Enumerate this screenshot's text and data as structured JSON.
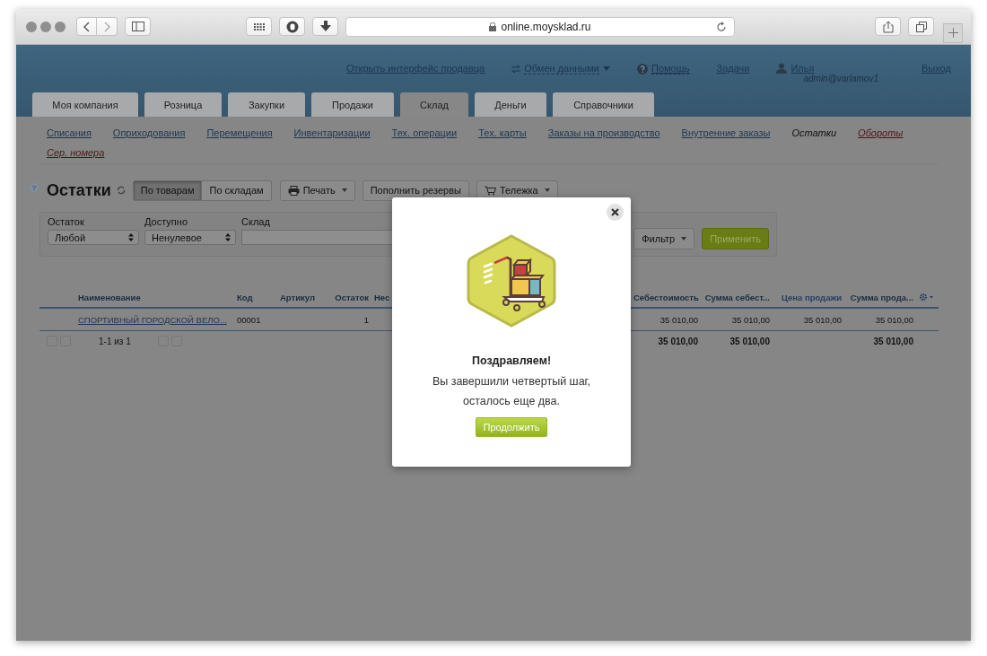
{
  "browser": {
    "url": "online.moysklad.ru"
  },
  "top_links": [
    {
      "label": "Открыть интерфейс продавца",
      "kind": "link"
    },
    {
      "label": "Обмен данными",
      "kind": "dropdown"
    },
    {
      "label": "Помощь",
      "kind": "help"
    },
    {
      "label": "Задачи",
      "kind": "link"
    },
    {
      "label": "Илья",
      "sub": "admin@varlamov1",
      "kind": "user"
    },
    {
      "label": "Выход",
      "kind": "link"
    }
  ],
  "tabs": [
    {
      "label": "Моя компания",
      "selected": false
    },
    {
      "label": "Розница",
      "selected": false
    },
    {
      "label": "Закупки",
      "selected": false
    },
    {
      "label": "Продажи",
      "selected": false
    },
    {
      "label": "Склад",
      "selected": true
    },
    {
      "label": "Деньги",
      "selected": false
    },
    {
      "label": "Справочники",
      "selected": false
    }
  ],
  "subnav": [
    {
      "label": "Списания",
      "selected": false,
      "kind": "normal"
    },
    {
      "label": "Оприходования",
      "selected": false,
      "kind": "normal"
    },
    {
      "label": "Перемещения",
      "selected": false,
      "kind": "normal"
    },
    {
      "label": "Инвентаризации",
      "selected": false,
      "kind": "normal"
    },
    {
      "label": "Тех. операции",
      "selected": false,
      "kind": "normal"
    },
    {
      "label": "Тех. карты",
      "selected": false,
      "kind": "normal"
    },
    {
      "label": "Заказы на производство",
      "selected": false,
      "kind": "normal"
    },
    {
      "label": "Внутренние заказы",
      "selected": false,
      "kind": "normal"
    },
    {
      "label": "Остатки",
      "selected": true,
      "kind": "normal"
    },
    {
      "label": "Обороты",
      "selected": false,
      "kind": "special"
    },
    {
      "label": "Сер. номера",
      "selected": false,
      "kind": "special"
    }
  ],
  "page": {
    "help_mark": "?",
    "title": "Остатки"
  },
  "view_toggle": [
    {
      "label": "По товарам",
      "selected": true
    },
    {
      "label": "По складам",
      "selected": false
    }
  ],
  "toolbar_buttons": [
    {
      "label": "Печать",
      "kind": "print"
    },
    {
      "label": "Пополнить резервы",
      "kind": "plain"
    },
    {
      "label": "Тележка",
      "kind": "cart"
    }
  ],
  "filters": [
    {
      "label": "Остаток",
      "kind": "select",
      "value": "Любой"
    },
    {
      "label": "Доступно",
      "kind": "select",
      "value": "Ненулевое"
    },
    {
      "label": "Склад",
      "kind": "input"
    }
  ],
  "filter_menu": "Фильтр",
  "apply_button": "Применить",
  "table": {
    "columns": [
      {
        "label": "Наименование",
        "highlighted": false
      },
      {
        "label": "Код",
        "highlighted": false
      },
      {
        "label": "Артикул",
        "highlighted": false
      },
      {
        "label": "Остаток",
        "highlighted": false
      },
      {
        "label": "Нес",
        "highlighted": false
      },
      {
        "label": "Себестоимость",
        "highlighted": false
      },
      {
        "label": "Сумма себест...",
        "highlighted": false
      },
      {
        "label": "Цена продажи",
        "highlighted": true
      },
      {
        "label": "Сумма прода...",
        "highlighted": false
      }
    ],
    "rows": [
      {
        "cells": [
          "СПОРТИВНЫЙ ГОРОДСКОЙ ВЕЛО...",
          "00001",
          "",
          "1",
          "",
          "35 010,00",
          "35 010,00",
          "35 010,00",
          "35 010,00"
        ]
      }
    ],
    "totals": {
      "cost": "35 010,00",
      "cost_sum": "35 010,00",
      "price_sum": "35 010,00"
    },
    "pager": "1-1 из 1"
  },
  "modal": {
    "title": "Поздравляем!",
    "lines": [
      "Вы завершили четвертый шаг,",
      "осталось еще два."
    ],
    "button": "Продолжить"
  }
}
